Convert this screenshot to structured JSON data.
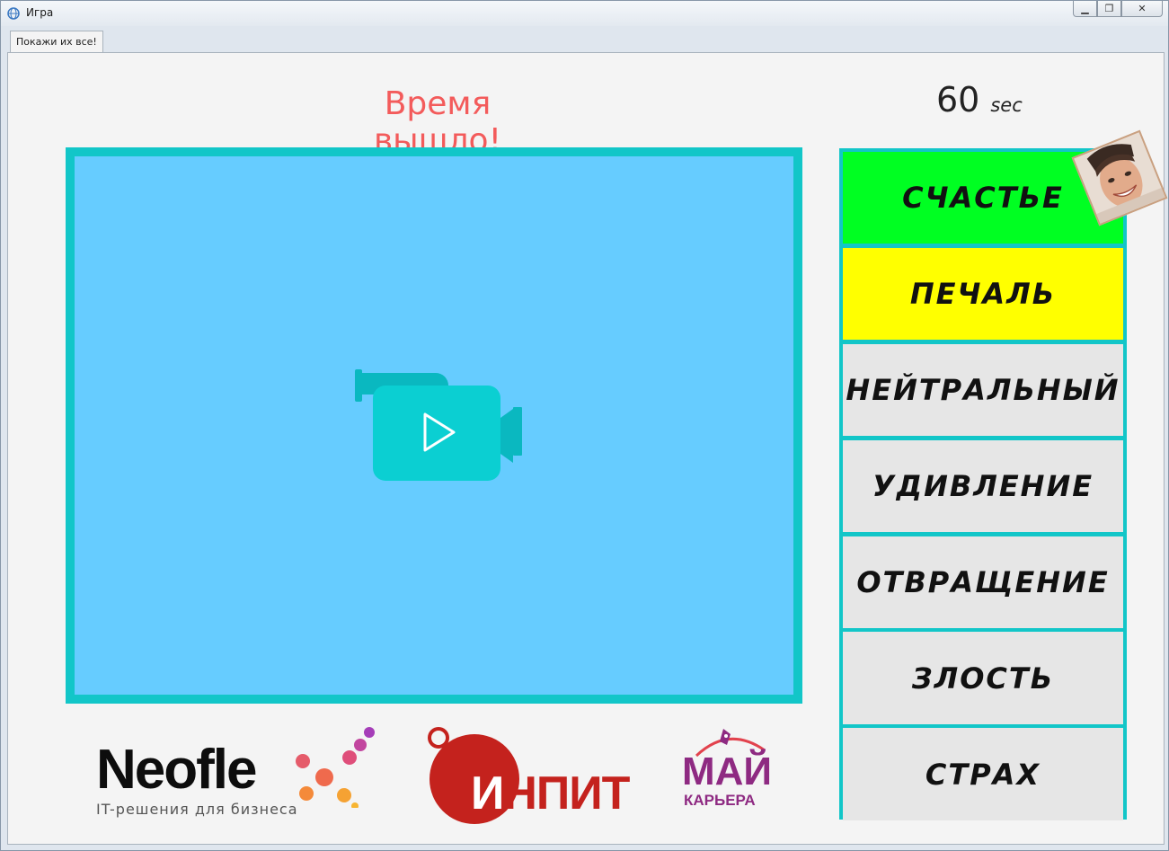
{
  "window": {
    "title": "Игра",
    "minimize_glyph": "▁",
    "restore_glyph": "❐",
    "close_glyph": "✕"
  },
  "tab": {
    "label": "Покажи их все!"
  },
  "status": {
    "message": "Время вышло!"
  },
  "timer": {
    "value": "60",
    "unit": "sec"
  },
  "video": {
    "icon": "video-camera-play-icon"
  },
  "emotions": [
    {
      "label": "СЧАСТЬЕ",
      "color": "#00ff22"
    },
    {
      "label": "ПЕЧАЛЬ",
      "color": "#ffff00"
    },
    {
      "label": "НЕЙТРАЛЬНЫЙ",
      "color": "#e6e6e6"
    },
    {
      "label": "УДИВЛЕНИЕ",
      "color": "#e6e6e6"
    },
    {
      "label": "ОТВРАЩЕНИЕ",
      "color": "#e6e6e6"
    },
    {
      "label": "ЗЛОСТЬ",
      "color": "#e6e6e6"
    },
    {
      "label": "СТРАХ",
      "color": "#e6e6e6"
    }
  ],
  "logos": {
    "neoflex": {
      "word": "Neofle",
      "sub": "IT-решения для бизнеса"
    },
    "inpit": {
      "first": "И",
      "rest": "НПИТ"
    },
    "mai": {
      "word": "МАЙ",
      "sub": "КАРЬЕРА"
    }
  },
  "colors": {
    "accent": "#12c6c8",
    "video_bg": "#66ccff",
    "status": "#f35b5b"
  }
}
